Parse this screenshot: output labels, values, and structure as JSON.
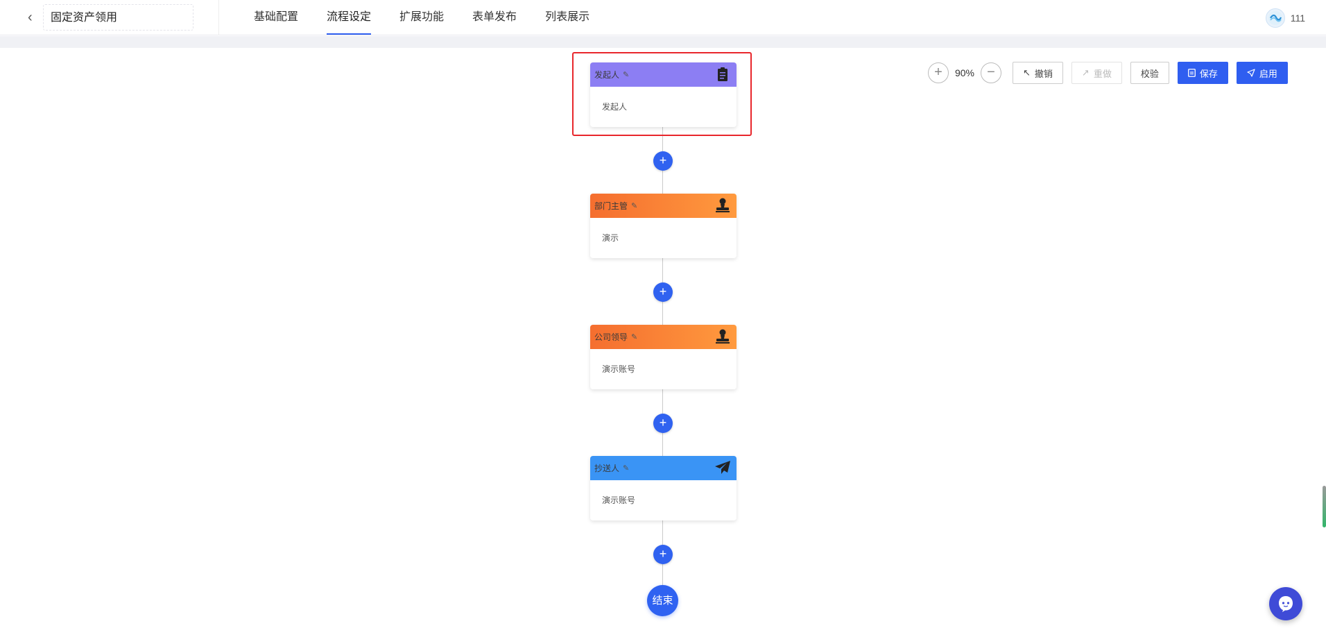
{
  "header": {
    "back_label": "<",
    "title": "固定资产领用",
    "tabs": [
      {
        "label": "基础配置",
        "active": false
      },
      {
        "label": "流程设定",
        "active": true
      },
      {
        "label": "扩展功能",
        "active": false
      },
      {
        "label": "表单发布",
        "active": false
      },
      {
        "label": "列表展示",
        "active": false
      }
    ],
    "user": {
      "name": "111"
    }
  },
  "toolbar": {
    "zoom_in_label": "+",
    "zoom_value": "90%",
    "zoom_out_label": "−",
    "undo_label": "撤销",
    "redo_label": "重做",
    "validate_label": "校验",
    "save_label": "保存",
    "enable_label": "启用"
  },
  "flow": {
    "nodes": [
      {
        "title": "发起人",
        "content": "发起人",
        "type": "initiator",
        "color": "#8c7ef3",
        "icon": "clipboard-icon"
      },
      {
        "title": "部门主管",
        "content": "演示",
        "type": "approver",
        "color": "#f56e2f",
        "icon": "stamp-icon"
      },
      {
        "title": "公司领导",
        "content": "演示账号",
        "type": "approver",
        "color": "#f56e2f",
        "icon": "stamp-icon"
      },
      {
        "title": "抄送人",
        "content": "演示账号",
        "type": "cc",
        "color": "#3a94f5",
        "icon": "paper-plane-icon"
      }
    ],
    "add_label": "+",
    "end_label": "结束"
  },
  "colors": {
    "accent": "#2f5ef0",
    "highlight": "#e8262b"
  }
}
